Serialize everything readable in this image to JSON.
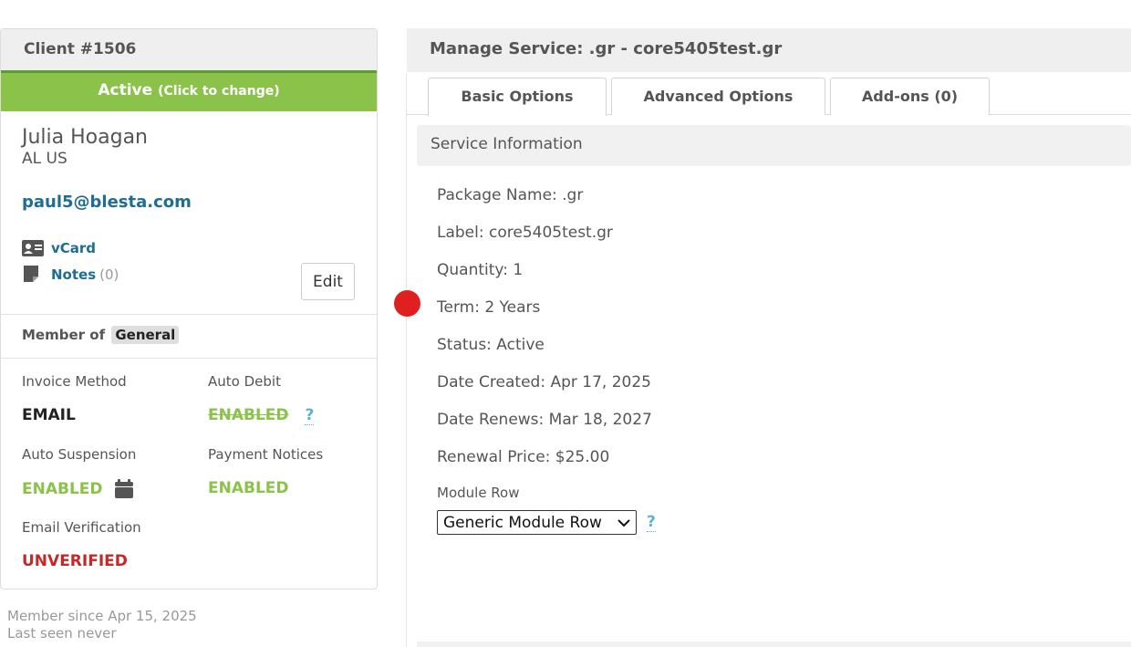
{
  "client": {
    "title": "Client #1506",
    "status": "Active",
    "status_hint": "(Click to change)",
    "name": "Julia Hoagan",
    "location": "AL US",
    "email": "paul5@blesta.com",
    "vcard_label": "vCard",
    "notes_label": "Notes",
    "notes_count": "(0)",
    "edit_label": "Edit",
    "member_of_label": "Member of",
    "group": "General",
    "invoice_method_label": "Invoice Method",
    "invoice_method_value": "EMAIL",
    "auto_debit_label": "Auto Debit",
    "auto_debit_value": "ENABLED",
    "auto_debit_help": "?",
    "auto_suspension_label": "Auto Suspension",
    "auto_suspension_value": "ENABLED",
    "payment_notices_label": "Payment Notices",
    "payment_notices_value": "ENABLED",
    "email_verification_label": "Email Verification",
    "email_verification_value": "UNVERIFIED",
    "member_since": "Member since Apr 15, 2025",
    "last_seen": "Last seen never"
  },
  "service": {
    "title": "Manage Service: .gr - core5405test.gr",
    "tabs": [
      {
        "label": "Basic Options",
        "active": true
      },
      {
        "label": "Advanced Options",
        "active": false
      },
      {
        "label": "Add-ons (0)",
        "active": false
      }
    ],
    "section_title": "Service Information",
    "info": [
      "Package Name: .gr",
      "Label: core5405test.gr",
      "Quantity: 1",
      "Term: 2 Years",
      "Status: Active",
      "Date Created: Apr 17, 2025",
      "Date Renews: Mar 18, 2027",
      "Renewal Price: $25.00"
    ],
    "module_row_label": "Module Row",
    "module_row_value": "Generic Module Row",
    "module_row_help": "?"
  },
  "colors": {
    "accent_green": "#8bc34a",
    "link_blue": "#1e6d95",
    "error_red": "#c62828",
    "help_cyan": "#56b6d2",
    "cursor_dot": "#e02020"
  }
}
